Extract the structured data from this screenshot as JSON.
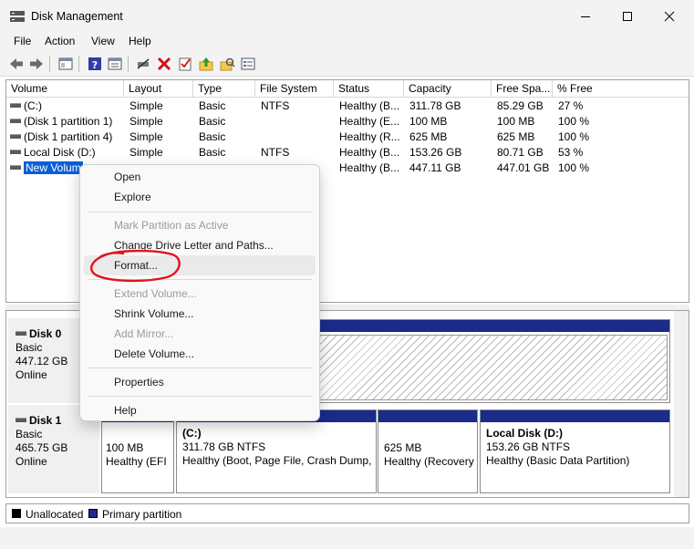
{
  "window": {
    "title": "Disk Management"
  },
  "menubar": {
    "items": [
      "File",
      "Action",
      "View",
      "Help"
    ]
  },
  "toolbar": {
    "icons": [
      "back-arrow-icon",
      "forward-arrow-icon",
      "console-tree-icon",
      "help-icon",
      "properties-icon",
      "connect-icon",
      "delete-icon",
      "checklist-icon",
      "up-folder-icon",
      "search-folder-icon",
      "settings-list-icon"
    ]
  },
  "volume_list": {
    "columns": [
      "Volume",
      "Layout",
      "Type",
      "File System",
      "Status",
      "Capacity",
      "Free Spa...",
      "% Free"
    ],
    "rows": [
      {
        "volume": "(C:)",
        "layout": "Simple",
        "type": "Basic",
        "fs": "NTFS",
        "status": "Healthy (B...",
        "capacity": "311.78 GB",
        "free": "85.29 GB",
        "pct": "27 %"
      },
      {
        "volume": "(Disk 1 partition 1)",
        "layout": "Simple",
        "type": "Basic",
        "fs": "",
        "status": "Healthy (E...",
        "capacity": "100 MB",
        "free": "100 MB",
        "pct": "100 %"
      },
      {
        "volume": "(Disk 1 partition 4)",
        "layout": "Simple",
        "type": "Basic",
        "fs": "",
        "status": "Healthy (R...",
        "capacity": "625 MB",
        "free": "625 MB",
        "pct": "100 %"
      },
      {
        "volume": "Local Disk (D:)",
        "layout": "Simple",
        "type": "Basic",
        "fs": "NTFS",
        "status": "Healthy (B...",
        "capacity": "153.26 GB",
        "free": "80.71 GB",
        "pct": "53 %"
      },
      {
        "volume": "New Volum",
        "layout": "",
        "type": "",
        "fs": "",
        "status": "Healthy (B...",
        "capacity": "447.11 GB",
        "free": "447.01 GB",
        "pct": "100 %"
      }
    ]
  },
  "disks": [
    {
      "name": "Disk 0",
      "type": "Basic",
      "size": "447.12 GB",
      "state": "Online"
    },
    {
      "name": "Disk 1",
      "type": "Basic",
      "size": "465.75 GB",
      "state": "Online"
    }
  ],
  "disk1_partitions": [
    {
      "name": "",
      "size": "100 MB",
      "status": "Healthy (EFI"
    },
    {
      "name": "(C:)",
      "size": "311.78 GB NTFS",
      "status": "Healthy (Boot, Page File, Crash Dump,"
    },
    {
      "name": "",
      "size": "625 MB",
      "status": "Healthy (Recovery"
    },
    {
      "name": "Local Disk  (D:)",
      "size": "153.26 GB NTFS",
      "status": "Healthy (Basic Data Partition)"
    }
  ],
  "legend": {
    "unallocated": "Unallocated",
    "primary": "Primary partition",
    "unallocated_color": "#000000",
    "primary_color": "#1a2b8a"
  },
  "context_menu": {
    "items": [
      {
        "label": "Open",
        "enabled": true
      },
      {
        "label": "Explore",
        "enabled": true
      },
      {
        "label": "Mark Partition as Active",
        "enabled": false
      },
      {
        "label": "Change Drive Letter and Paths...",
        "enabled": true
      },
      {
        "label": "Format...",
        "enabled": true,
        "highlighted": true
      },
      {
        "label": "Extend Volume...",
        "enabled": false
      },
      {
        "label": "Shrink Volume...",
        "enabled": true
      },
      {
        "label": "Add Mirror...",
        "enabled": false
      },
      {
        "label": "Delete Volume...",
        "enabled": true
      },
      {
        "label": "Properties",
        "enabled": true
      },
      {
        "label": "Help",
        "enabled": true
      }
    ]
  },
  "colors": {
    "selection": "#0a5fd6",
    "partition_header": "#1a2b8a",
    "annotation": "#e0141e"
  }
}
